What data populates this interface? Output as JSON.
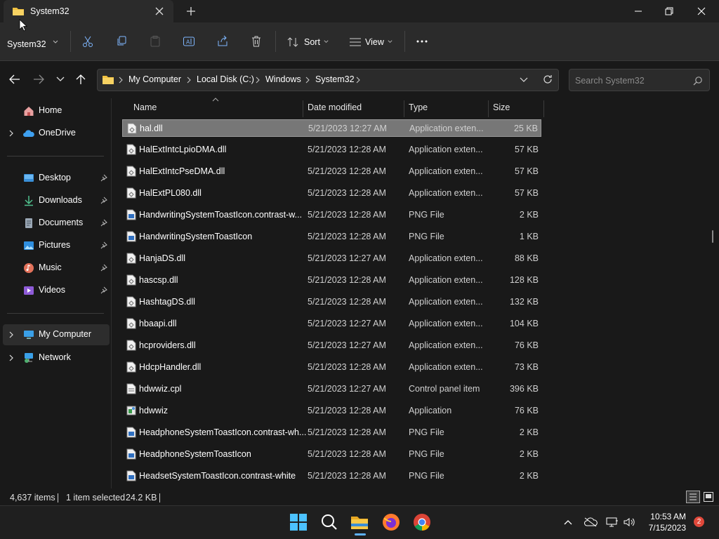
{
  "window": {
    "tab_title": "System32",
    "colors": {
      "bg": "#191919",
      "toolbar": "#2b2b2b",
      "selection": "#777777",
      "folder": "#f0c040",
      "badge": "#e0483a"
    }
  },
  "toolbar": {
    "location_label": "System32",
    "sort_label": "Sort",
    "view_label": "View"
  },
  "address": {
    "crumbs": [
      "My Computer",
      "Local Disk (C:)",
      "Windows",
      "System32"
    ]
  },
  "search": {
    "placeholder": "Search System32"
  },
  "nav": {
    "home": "Home",
    "onedrive": "OneDrive",
    "desktop": "Desktop",
    "downloads": "Downloads",
    "documents": "Documents",
    "pictures": "Pictures",
    "music": "Music",
    "videos": "Videos",
    "my_computer": "My Computer",
    "network": "Network"
  },
  "columns": {
    "name": "Name",
    "date": "Date modified",
    "type": "Type",
    "size": "Size"
  },
  "files": [
    {
      "name": "hal.dll",
      "date": "5/21/2023 12:27 AM",
      "type": "Application exten...",
      "size": "25 KB",
      "icon": "dll-icon",
      "selected": true
    },
    {
      "name": "HalExtIntcLpioDMA.dll",
      "date": "5/21/2023 12:28 AM",
      "type": "Application exten...",
      "size": "57 KB",
      "icon": "dll-icon"
    },
    {
      "name": "HalExtIntcPseDMA.dll",
      "date": "5/21/2023 12:28 AM",
      "type": "Application exten...",
      "size": "57 KB",
      "icon": "dll-icon"
    },
    {
      "name": "HalExtPL080.dll",
      "date": "5/21/2023 12:28 AM",
      "type": "Application exten...",
      "size": "57 KB",
      "icon": "dll-icon"
    },
    {
      "name": "HandwritingSystemToastIcon.contrast-w...",
      "date": "5/21/2023 12:28 AM",
      "type": "PNG File",
      "size": "2 KB",
      "icon": "png-icon"
    },
    {
      "name": "HandwritingSystemToastIcon",
      "date": "5/21/2023 12:28 AM",
      "type": "PNG File",
      "size": "1 KB",
      "icon": "png-icon"
    },
    {
      "name": "HanjaDS.dll",
      "date": "5/21/2023 12:27 AM",
      "type": "Application exten...",
      "size": "88 KB",
      "icon": "dll-icon"
    },
    {
      "name": "hascsp.dll",
      "date": "5/21/2023 12:28 AM",
      "type": "Application exten...",
      "size": "128 KB",
      "icon": "dll-icon"
    },
    {
      "name": "HashtagDS.dll",
      "date": "5/21/2023 12:28 AM",
      "type": "Application exten...",
      "size": "132 KB",
      "icon": "dll-icon"
    },
    {
      "name": "hbaapi.dll",
      "date": "5/21/2023 12:27 AM",
      "type": "Application exten...",
      "size": "104 KB",
      "icon": "dll-icon"
    },
    {
      "name": "hcproviders.dll",
      "date": "5/21/2023 12:27 AM",
      "type": "Application exten...",
      "size": "76 KB",
      "icon": "dll-icon"
    },
    {
      "name": "HdcpHandler.dll",
      "date": "5/21/2023 12:28 AM",
      "type": "Application exten...",
      "size": "73 KB",
      "icon": "dll-icon"
    },
    {
      "name": "hdwwiz.cpl",
      "date": "5/21/2023 12:27 AM",
      "type": "Control panel item",
      "size": "396 KB",
      "icon": "cpl-icon"
    },
    {
      "name": "hdwwiz",
      "date": "5/21/2023 12:28 AM",
      "type": "Application",
      "size": "76 KB",
      "icon": "exe-icon"
    },
    {
      "name": "HeadphoneSystemToastIcon.contrast-wh...",
      "date": "5/21/2023 12:28 AM",
      "type": "PNG File",
      "size": "2 KB",
      "icon": "png-icon"
    },
    {
      "name": "HeadphoneSystemToastIcon",
      "date": "5/21/2023 12:28 AM",
      "type": "PNG File",
      "size": "2 KB",
      "icon": "png-icon"
    },
    {
      "name": "HeadsetSystemToastIcon.contrast-white",
      "date": "5/21/2023 12:28 AM",
      "type": "PNG File",
      "size": "2 KB",
      "icon": "png-icon"
    }
  ],
  "status": {
    "items": "4,637 items",
    "selected": "1 item selected",
    "size": "24.2 KB"
  },
  "taskbar": {
    "time": "10:53 AM",
    "date": "7/15/2023",
    "badge": "2"
  }
}
